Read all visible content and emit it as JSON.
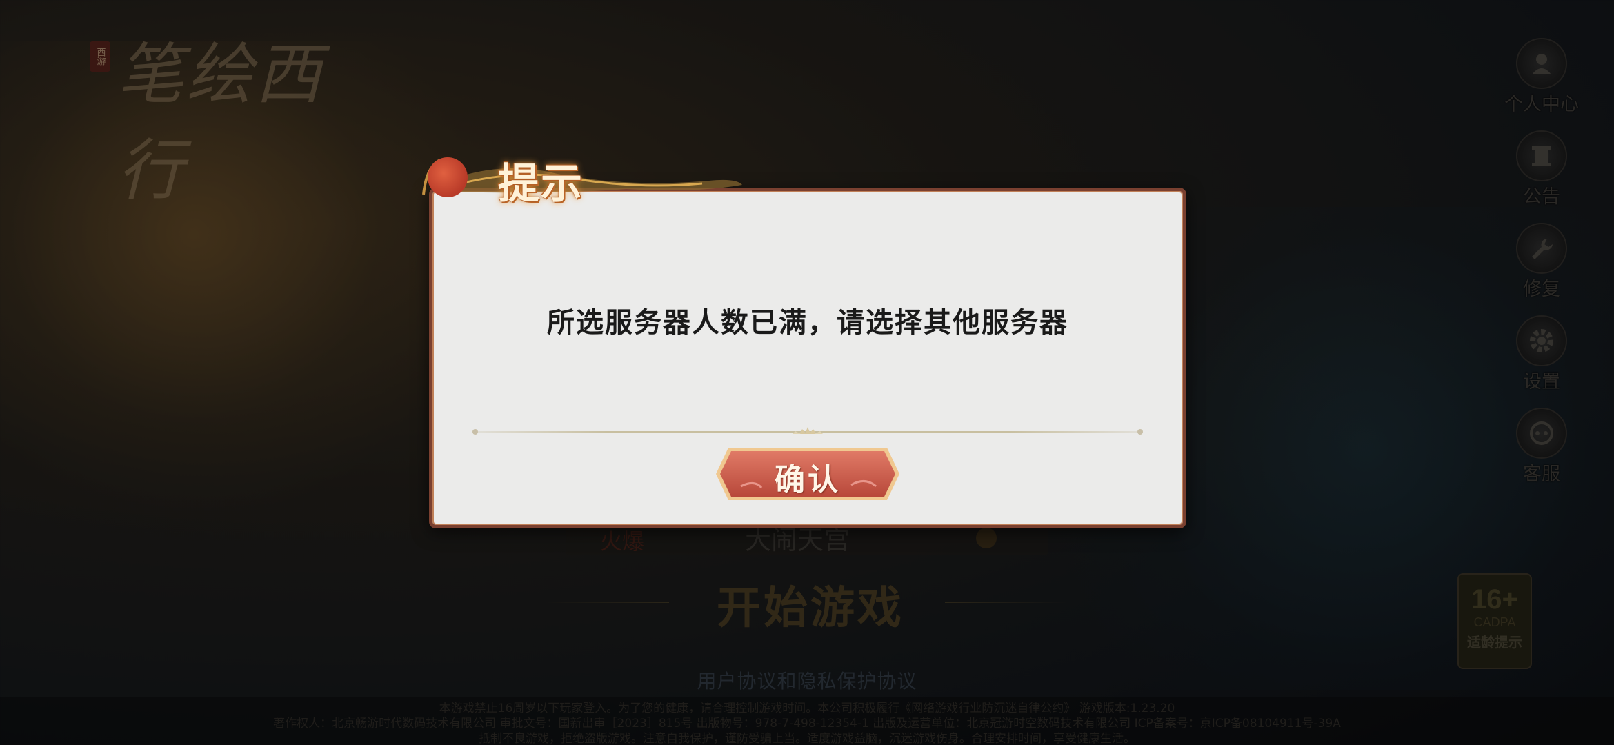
{
  "game": {
    "logo_seal": "西游",
    "logo_title": "笔绘西行"
  },
  "side_menu": [
    {
      "id": "personal-center",
      "label": "个人中心",
      "icon": "person-icon"
    },
    {
      "id": "announcement",
      "label": "公告",
      "icon": "announcement-icon"
    },
    {
      "id": "repair",
      "label": "修复",
      "icon": "wrench-icon"
    },
    {
      "id": "settings",
      "label": "设置",
      "icon": "gear-icon"
    },
    {
      "id": "customer-service",
      "label": "客服",
      "icon": "headset-icon"
    }
  ],
  "age_rating": {
    "age": "16+",
    "org": "CADPA",
    "hint": "适龄提示"
  },
  "lobby": {
    "server_tag": "火爆",
    "server_name": "大闹天宫",
    "start_button": "开始游戏",
    "agreement_link": "用户协议和隐私保护协议"
  },
  "footer": {
    "line1": "本游戏禁止16周岁以下玩家登入。为了您的健康，请合理控制游戏时间。本公司积极履行《网络游戏行业防沉迷自律公约》 游戏版本:1.23.20",
    "line2": "著作权人：北京畅游时代数码技术有限公司 审批文号：国新出审［2023］815号 出版物号：978-7-498-12354-1 出版及运营单位：北京冠游时空数码技术有限公司 ICP备案号：京ICP备08104911号-39A",
    "line3": "抵制不良游戏，拒绝盗版游戏。注意自我保护，谨防受骗上当。适度游戏益脑，沉迷游戏伤身。合理安排时间，享受健康生活。"
  },
  "dialog": {
    "title": "提示",
    "message": "所选服务器人数已满，请选择其他服务器",
    "confirm_label": "确认"
  },
  "colors": {
    "dialog_bg": "#ebebea",
    "dialog_border": "#7a4030",
    "confirm_button": "#c65a4a",
    "title_glow": "#f0a040"
  }
}
